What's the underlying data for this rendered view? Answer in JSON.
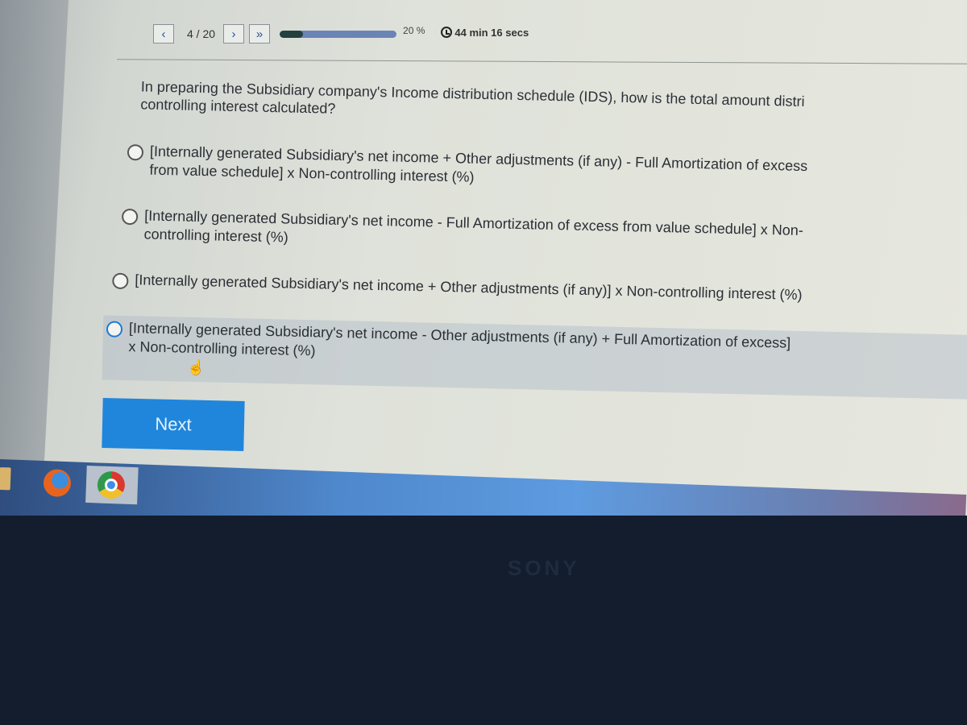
{
  "navigation": {
    "prev_icon": "‹",
    "page_indicator": "4 / 20",
    "next_icon": "›",
    "last_icon": "»",
    "progress_percent": 20,
    "progress_label": "20 %",
    "timer_label": "44 min 16 secs"
  },
  "question": {
    "line1": "In preparing the Subsidiary company's Income distribution schedule (IDS), how is the total amount distri",
    "line2": "controlling interest calculated?"
  },
  "options": [
    {
      "line1": "[Internally generated Subsidiary's net income + Other adjustments (if any) - Full Amortization of excess",
      "line2": "from value schedule] x Non-controlling interest (%)"
    },
    {
      "line1": "[Internally generated Subsidiary's net income - Full Amortization of excess from value schedule] x Non-",
      "line2": "controlling interest (%)"
    },
    {
      "line1": "[Internally generated Subsidiary's net income + Other adjustments (if any)] x Non-controlling interest (%)",
      "line2": ""
    },
    {
      "line1": "[Internally generated Subsidiary's net income - Other adjustments (if any) + Full Amortization of excess]",
      "line2": "x Non-controlling interest (%)"
    }
  ],
  "next_button": {
    "label": "Next",
    "color": "#1f86dc"
  },
  "taskbar": {
    "icons": [
      "file-explorer-icon",
      "firefox-icon",
      "chrome-icon"
    ]
  },
  "bezel": {
    "brand": "SONY"
  }
}
